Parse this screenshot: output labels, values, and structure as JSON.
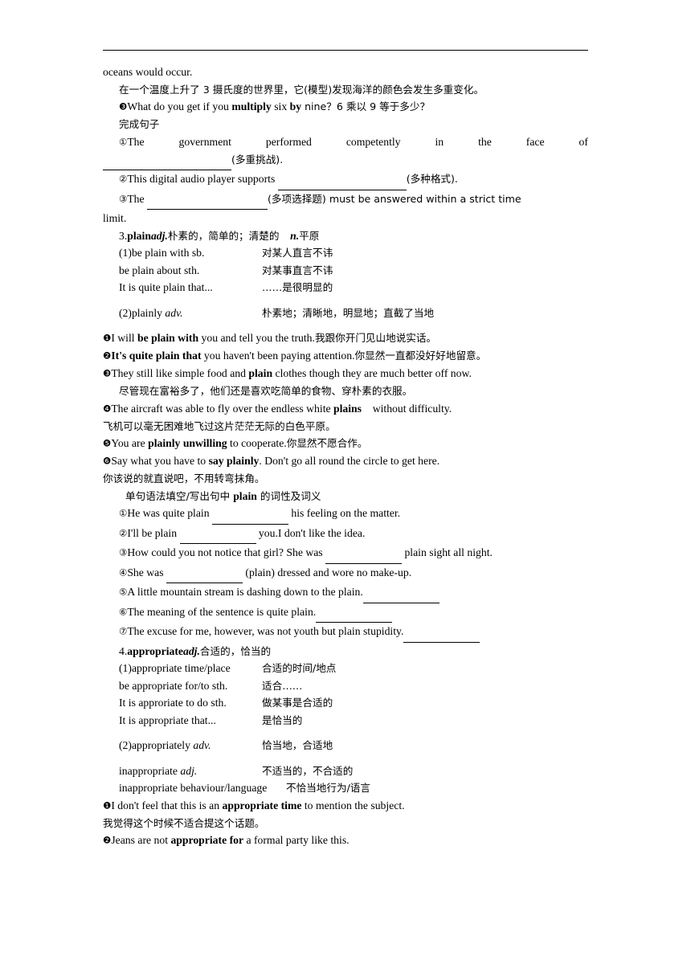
{
  "document": {
    "line_oceans": "oceans would occur.",
    "line_oceans_cn": "在一个温度上升了 3 摄氏度的世界里，它(模型)发现海洋的颜色会发生多重变化。",
    "item3_en_a": "What do you get if you ",
    "item3_bold_a": "multiply",
    "item3_en_b": " six ",
    "item3_bold_b": "by",
    "item3_en_c": " nine？6 乘以 9 等于多少？",
    "complete_sentences_label": "完成句子",
    "ex1_part1": "The",
    "ex1_part2": "government",
    "ex1_part3": "performed",
    "ex1_part4": "competently",
    "ex1_part5": "in",
    "ex1_part6": "the",
    "ex1_part7": "face",
    "ex1_part8": "of",
    "ex1_tail": "(多重挑战).",
    "ex2_text": "This digital audio player supports ",
    "ex2_tail": "(多种格式).",
    "ex3_head": "The ",
    "ex3_mid": "(多项选择题) must be answered within a strict time",
    "ex3_tail": "limit.",
    "entry3_title_num": "3.",
    "entry3_word": "plain",
    "entry3_pos": "adj.",
    "entry3_def": "朴素的，简单的；清楚的",
    "entry3_pos2": "n.",
    "entry3_def2": "平原",
    "entry3_phrases": [
      {
        "en": "(1)be plain with sb.",
        "cn": "对某人直言不讳"
      },
      {
        "en": "be plain about sth.",
        "cn": "对某事直言不讳"
      },
      {
        "en": "It is quite plain that...",
        "cn": "……是很明显的"
      },
      {
        "en": "(2)plainly adv.",
        "cn": "朴素地；清晰地，明显地；直截了当地"
      }
    ],
    "entry3_examples": [
      {
        "marker": "❶",
        "pre": "I will ",
        "bold": "be plain with",
        "post": " you and tell you the truth.",
        "cn_inline": "我跟你开门见山地说实话。"
      },
      {
        "marker": "❷",
        "pre": "",
        "bold": "It's quite plain that",
        "post": " you haven't been paying attention.",
        "cn_inline": "你显然一直都没好好地留意。"
      },
      {
        "marker": "❸",
        "pre": "They still like simple food and ",
        "bold": "plain",
        "post": " clothes though they are much better off now.",
        "cn_line": "尽管现在富裕多了，他们还是喜欢吃简单的食物、穿朴素的衣服。"
      },
      {
        "marker": "❹",
        "pre": "The aircraft was able to fly over the endless white ",
        "bold": "plains",
        "post": "　without difficulty.",
        "cn_line": "飞机可以毫无困难地飞过这片茫茫无际的白色平原。"
      },
      {
        "marker": "❺",
        "pre": "You are ",
        "bold": "plainly unwilling",
        "post": " to cooperate.",
        "cn_inline": "你显然不愿合作。"
      },
      {
        "marker": "❻",
        "pre": "Say what you have to ",
        "bold": "say plainly",
        "post": ". Don't go all round the circle to get here.",
        "cn_line": "你该说的就直说吧，不用转弯抹角。"
      }
    ],
    "entry3_task_pre": "单句语法填空/写出句中 ",
    "entry3_task_bold": "plain",
    "entry3_task_post": " 的词性及词义",
    "entry3_questions": [
      {
        "num": "①",
        "pre": "He was quite plain ",
        "blank": 95,
        "post": " his feeling on the matter."
      },
      {
        "num": "②",
        "pre": "I'll be plain ",
        "blank": 95,
        "post": " you.I don't like the idea."
      },
      {
        "num": "③",
        "pre": "How could you not notice that girl? She was ",
        "blank": 95,
        "post": " plain sight all night."
      },
      {
        "num": "④",
        "pre": "She was ",
        "blank": 95,
        "post": " (plain) dressed and wore no make-up."
      },
      {
        "num": "⑤",
        "pre": "A little mountain stream is dashing down to the plain.",
        "blank": 95,
        "post": ""
      },
      {
        "num": "⑥",
        "pre": "The meaning of the sentence is quite plain.",
        "blank": 95,
        "post": ""
      },
      {
        "num": "⑦",
        "pre": "The excuse for me, however, was not youth but plain stupidity.",
        "blank": 95,
        "post": ""
      }
    ],
    "entry4_title_num": "4.",
    "entry4_word": "appropriate",
    "entry4_pos": "adj.",
    "entry4_def": "合适的，恰当的",
    "entry4_phrases": [
      {
        "en": "(1)appropriate time/place",
        "cn": "合适的时间/地点"
      },
      {
        "en": "be appropriate for/to sth.",
        "cn": "适合……"
      },
      {
        "en": "It is approriate to do sth.",
        "cn": "做某事是合适的"
      },
      {
        "en": "It is appropriate that...",
        "cn": "是恰当的"
      },
      {
        "en": "(2)appropriately adv.",
        "cn": "恰当地，合适地"
      },
      {
        "en": "inappropriate adj.",
        "cn": "不适当的，不合适的"
      },
      {
        "en": "inappropriate behaviour/language",
        "cn": "不恰当地行为/语言"
      }
    ],
    "entry4_examples": [
      {
        "marker": "❶",
        "pre": "I don't feel that this is an ",
        "bold": "appropriate time",
        "post": " to mention the subject.",
        "cn_line": "我觉得这个时候不适合提这个话题。"
      },
      {
        "marker": "❷",
        "pre": "Jeans are not ",
        "bold": "appropriate for",
        "post": " a formal party like this.",
        "cn_line": ""
      }
    ]
  }
}
